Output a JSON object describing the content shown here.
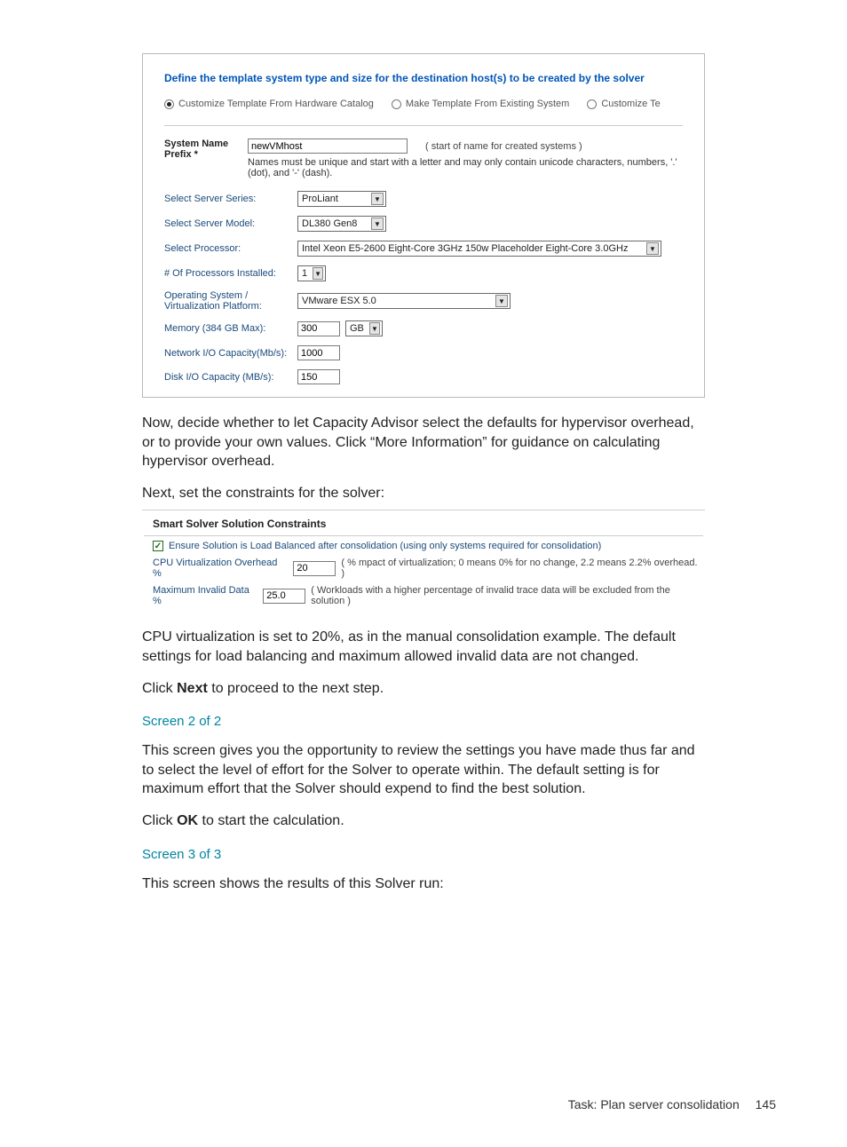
{
  "box1": {
    "heading": "Define the template system type and size for the destination host(s) to be created by the solver",
    "radios": {
      "opt1": "Customize Template From Hardware Catalog",
      "opt2": "Make Template From Existing System",
      "opt3": "Customize Te"
    },
    "prefix": {
      "label": "System Name Prefix *",
      "value": "newVMhost",
      "hint1": "( start of name for created systems )",
      "note": "Names must be unique and start with a letter and may only contain unicode characters, numbers, '.' (dot), and '-' (dash)."
    },
    "rows": {
      "series_label": "Select Server Series:",
      "series_value": "ProLiant",
      "model_label": "Select Server Model:",
      "model_value": "DL380 Gen8",
      "proc_label": "Select Processor:",
      "proc_value": "Intel Xeon E5-2600 Eight-Core 3GHz 150w Placeholder Eight-Core 3.0GHz",
      "numproc_label": "# Of Processors Installed:",
      "numproc_value": "1",
      "os_label": "Operating System / Virtualization Platform:",
      "os_value": "VMware ESX 5.0",
      "mem_label": "Memory (384 GB Max):",
      "mem_value": "300",
      "mem_unit": "GB",
      "net_label": "Network I/O Capacity(Mb/s):",
      "net_value": "1000",
      "disk_label": "Disk I/O Capacity (MB/s):",
      "disk_value": "150"
    }
  },
  "body": {
    "p1": "Now, decide whether to let Capacity Advisor select the defaults for hypervisor overhead, or to provide your own values. Click “More Information” for guidance on calculating hypervisor overhead.",
    "p2": "Next, set the constraints for the solver:"
  },
  "box2": {
    "title": "Smart Solver Solution Constraints",
    "cb_label": "Ensure Solution is Load Balanced after consolidation (using only systems required for consolidation)",
    "row1_label": "CPU Virtualization Overhead %",
    "row1_value": "20",
    "row1_hint": "( % mpact of virtualization; 0 means 0% for no change, 2.2 means 2.2% overhead. )",
    "row2_label": "Maximum Invalid Data %",
    "row2_value": "25.0",
    "row2_hint": "( Workloads with a higher percentage of invalid trace data will be excluded from the solution )"
  },
  "body2": {
    "p3": "CPU virtualization is set to 20%, as in the manual consolidation example. The default settings for load balancing and maximum allowed invalid data are not changed.",
    "p4a": "Click ",
    "p4b": "Next",
    "p4c": " to proceed to the next step.",
    "h2": "Screen 2 of 2",
    "p5": "This screen gives you the opportunity to review the settings you have made thus far and to select the level of effort for the Solver to operate within. The default setting is for maximum effort that the Solver should expend to find the best solution.",
    "p6a": "Click ",
    "p6b": "OK",
    "p6c": " to start the calculation.",
    "h3": "Screen 3 of 3",
    "p7": "This screen shows the results of this Solver run:"
  },
  "footer": {
    "task": "Task: Plan server consolidation",
    "page": "145"
  }
}
